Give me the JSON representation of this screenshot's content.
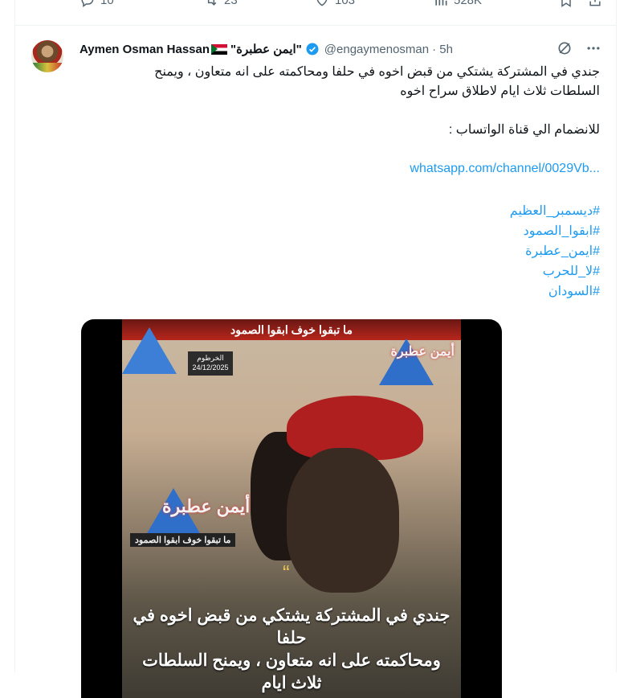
{
  "prev_tweet_actions": {
    "replies": "10",
    "reposts": "23",
    "likes": "103",
    "views": "528K"
  },
  "tweet": {
    "author_name": "Aymen Osman Hassan",
    "author_alt_name": "\"ايمن عطبرة\"",
    "handle": "@engaymenosman",
    "time": "· 5h",
    "text_line1": "جندي في المشتركة يشتكي من قبض اخوه في حلفا ومحاكمته على انه متعاون ، ويمنح",
    "text_line2": "السلطات ثلاث ايام لاطلاق سراح اخوه",
    "text_line3": "للانضمام الي قناة الواتساب :",
    "link": "whatsapp.com/channel/0029Vb...",
    "hashtags": [
      "#ديسمبر_العظيم",
      "#ابقوا_الصمود",
      "#ايمن_عطبرة",
      "#لا_للحرب",
      "#السودان"
    ]
  },
  "video": {
    "banner": "ما تبقوا خوف ابقوا الصمود",
    "date": "24/12/2025",
    "location": "الخرطوم",
    "watermark": "أيمن عطبرة",
    "watermark_sub": "ما تبقوا خوف   ابقوا الصمود",
    "caption_line1": "جندي في المشتركة يشتكي من قبض اخوه في حلفا",
    "caption_line2": "ومحاكمته على انه متعاون ، ويمنح السلطات ثلاث ايام"
  },
  "icons": {
    "reply": "reply-icon",
    "repost": "repost-icon",
    "like": "heart-icon",
    "views": "views-icon",
    "bookmark": "bookmark-icon",
    "share": "share-icon",
    "grok": "grok-icon",
    "more": "more-icon",
    "verified": "verified-badge-icon"
  },
  "colors": {
    "link": "#1d9bf0",
    "secondary_text": "#536471",
    "verified": "#1d9bf0"
  }
}
